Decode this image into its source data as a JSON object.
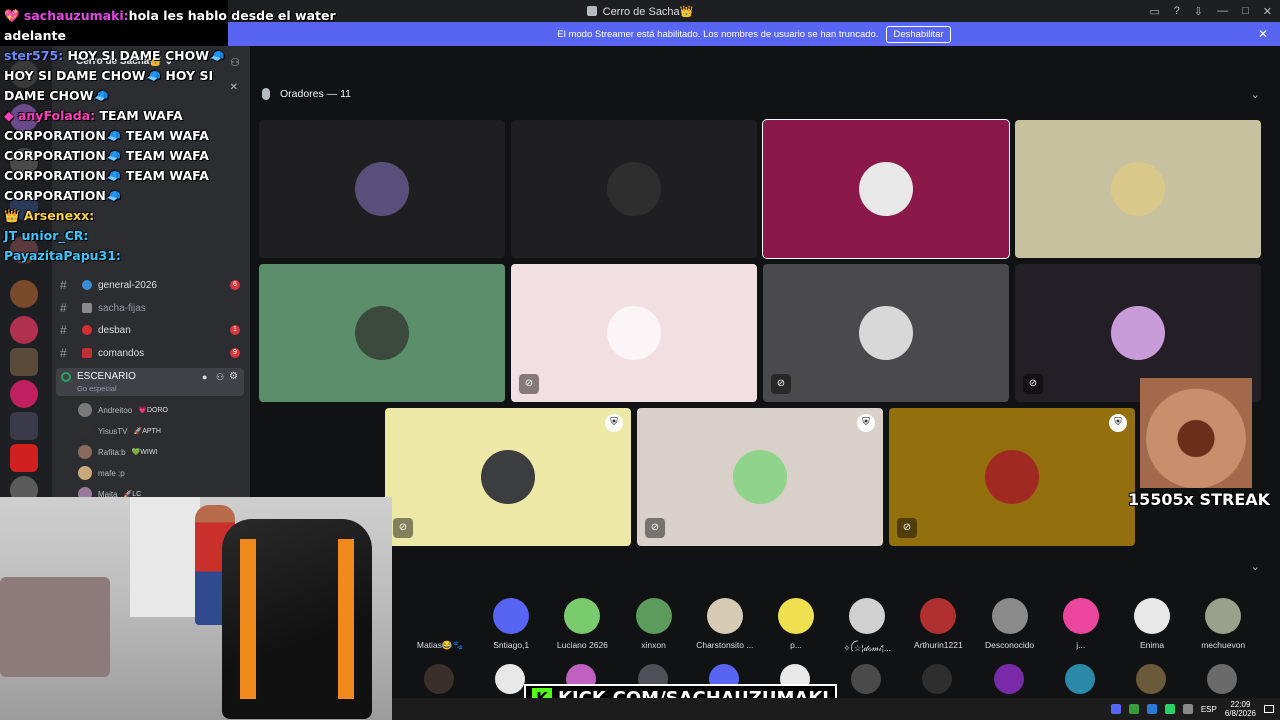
{
  "window": {
    "title": "Cerro de Sacha👑",
    "controls": [
      "▭",
      "?",
      "⇩",
      "—",
      "□",
      "✕"
    ]
  },
  "banner": {
    "text": "El modo Streamer está habilitado. Los nombres de usuario se han truncado.",
    "button": "Deshabilitar"
  },
  "server": {
    "name": "Cerro de Sacha👑 ⌄"
  },
  "sidebar": {
    "channels": [
      {
        "label": "general-2026",
        "badge": "6"
      },
      {
        "label": "sacha-fijas",
        "badge": ""
      },
      {
        "label": "desban",
        "badge": "1"
      },
      {
        "label": "comandos",
        "badge": "9"
      }
    ],
    "stage": {
      "name": "ESCENARIO",
      "subtitle": "Go especial"
    },
    "members": [
      {
        "name": "Andreitoo",
        "tag": "💗DORO"
      },
      {
        "name": "YisusTV",
        "tag": "🚀APTH"
      },
      {
        "name": "Rafita:b",
        "tag": "💚WIWI"
      },
      {
        "name": "mafe :p",
        "tag": ""
      },
      {
        "name": "Maita",
        "tag": "🚀LC"
      }
    ]
  },
  "chat": {
    "messages": [
      {
        "user": "💖 sachauzumaki:",
        "text": "hola les hablo desde el water"
      },
      {
        "user": "",
        "text": "adelante"
      },
      {
        "user": "ster575:",
        "text": " HOY SI DAME CHOW🧢"
      },
      {
        "user": "",
        "text": "HOY SI DAME CHOW🧢 HOY SI"
      },
      {
        "user": "",
        "text": "DAME CHOW🧢"
      },
      {
        "user": "◆ anyFolada:",
        "text": " TEAM WAFA"
      },
      {
        "user": "",
        "text": "CORPORATION🧢 TEAM WAFA"
      },
      {
        "user": "",
        "text": "CORPORATION🧢 TEAM WAFA"
      },
      {
        "user": "",
        "text": "CORPORATION🧢 TEAM WAFA"
      },
      {
        "user": "",
        "text": "CORPORATION🧢"
      },
      {
        "user": "👑 Arsenexx:",
        "text": ""
      },
      {
        "user": "JT unior_CR:",
        "text": ""
      },
      {
        "user": "PayazitaPapu31:",
        "text": ""
      }
    ]
  },
  "stage": {
    "speakers_label": "Oradores — 11",
    "tiles": [
      {
        "bg": "#1f1f22",
        "avatar": "#5a4f7a",
        "muted": false,
        "mod": false
      },
      {
        "bg": "#1f1f22",
        "avatar": "#2e2e2e",
        "muted": false,
        "mod": false
      },
      {
        "bg": "#8a1848",
        "avatar": "#e8e8e8",
        "muted": false,
        "mod": false
      },
      {
        "bg": "#c8c19f",
        "avatar": "#d8c98a",
        "muted": false,
        "mod": false
      },
      {
        "bg": "#5b8f6c",
        "avatar": "#3b4a3c",
        "muted": false,
        "mod": false
      },
      {
        "bg": "#f1dfe2",
        "avatar": "#fbf5f7",
        "muted": true,
        "mod": false
      },
      {
        "bg": "#4a4a4c",
        "avatar": "#d8d8d8",
        "muted": true,
        "mod": false
      },
      {
        "bg": "#241f26",
        "avatar": "#c89bd9",
        "muted": true,
        "mod": false
      },
      {
        "bg": "#ede8a6",
        "avatar": "#3b3d3f",
        "muted": true,
        "mod": true
      },
      {
        "bg": "#d9d1c9",
        "avatar": "#8fd48a",
        "muted": true,
        "mod": true
      },
      {
        "bg": "#946f0e",
        "avatar": "#a02a22",
        "muted": true,
        "mod": true
      }
    ],
    "audience": [
      {
        "name": "Matias😂🐾",
        "color": "#111214"
      },
      {
        "name": "Sntiago,1",
        "color": "#5865f2"
      },
      {
        "name": "Luciano 2626",
        "color": "#7acb6e"
      },
      {
        "name": "xinxon",
        "color": "#5c9c5c"
      },
      {
        "name": "Charstonsito ...",
        "color": "#d8cbb5"
      },
      {
        "name": "p...",
        "color": "#f0e050"
      },
      {
        "name": "✧ꪶ☆¦𝒹ℴ𝓂𝒾¦...",
        "color": "#d0d0d0"
      },
      {
        "name": "Arthurin1221",
        "color": "#b03030"
      },
      {
        "name": "Desconocido",
        "color": "#8a8a8a"
      },
      {
        "name": "j...",
        "color": "#eb459e"
      },
      {
        "name": "Enima",
        "color": "#e8e8e8"
      },
      {
        "name": "mechuevon",
        "color": "#9aa08a"
      }
    ],
    "audience_row2": [
      "#3a2f2a",
      "#e8e8e8",
      "#c060c0",
      "#4e5058",
      "#5865f2",
      "#e8e8e8",
      "#4a4a4a",
      "#2e2e2e",
      "#7a2aa8",
      "#2a8aa8",
      "#6a5a3a",
      "#6a6a6a"
    ]
  },
  "overlay": {
    "streak": "15505x STREAK",
    "kick_url": "KICK.COM/SACHAUZUMAKI"
  },
  "taskbar": {
    "lang": "ESP",
    "time": "22:09",
    "date": "6/8/2026"
  }
}
